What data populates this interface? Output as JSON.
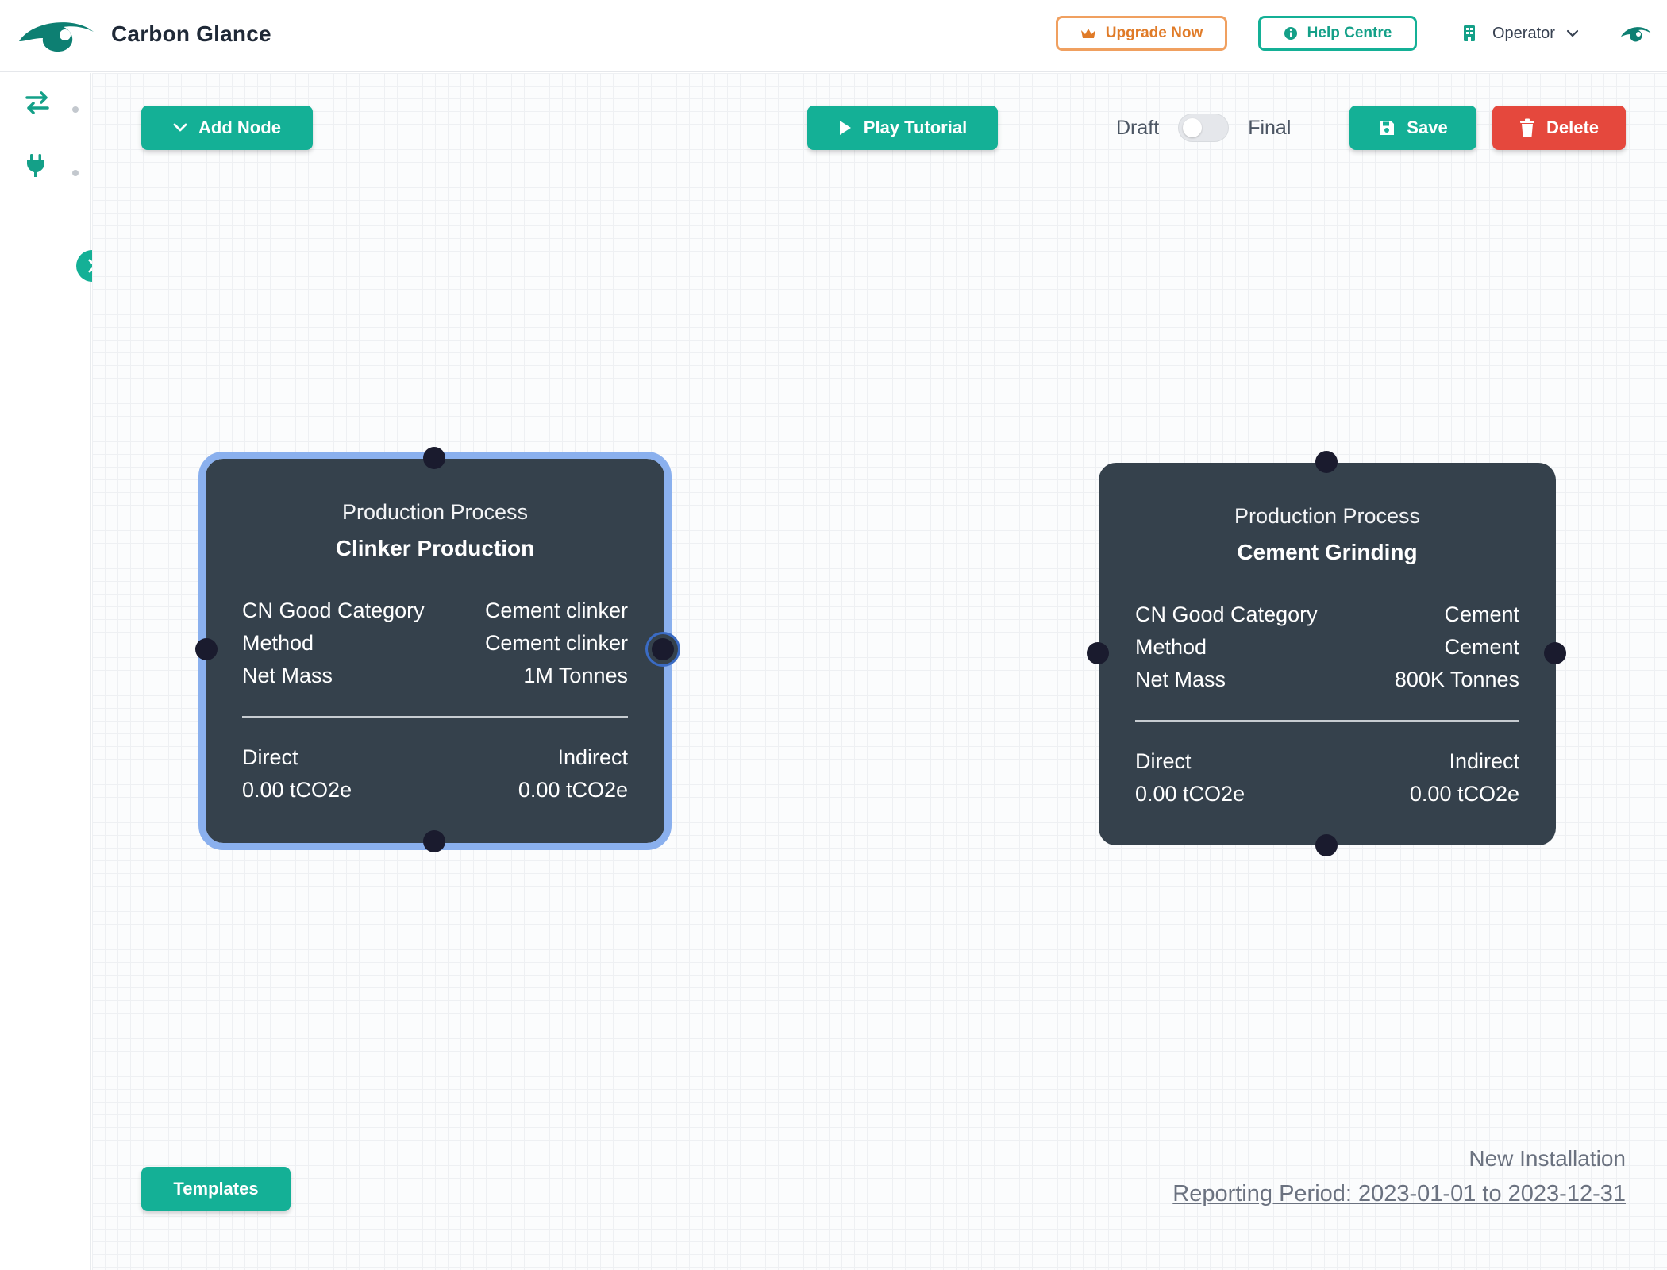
{
  "app": {
    "name": "Carbon Glance"
  },
  "header": {
    "upgrade_label": "Upgrade Now",
    "help_label": "Help Centre",
    "role_label": "Operator"
  },
  "toolbar": {
    "add_node_label": "Add Node",
    "play_tutorial_label": "Play Tutorial",
    "draft_label": "Draft",
    "final_label": "Final",
    "status_is_final": false,
    "save_label": "Save",
    "delete_label": "Delete"
  },
  "nodes": [
    {
      "type": "Production Process",
      "name": "Clinker Production",
      "selected": true,
      "rows": [
        {
          "label": "CN Good Category",
          "value": "Cement clinker"
        },
        {
          "label": "Method",
          "value": "Cement clinker"
        },
        {
          "label": "Net Mass",
          "value": "1M Tonnes"
        }
      ],
      "direct_label": "Direct",
      "direct_value": "0.00 tCO2e",
      "indirect_label": "Indirect",
      "indirect_value": "0.00 tCO2e"
    },
    {
      "type": "Production Process",
      "name": "Cement Grinding",
      "selected": false,
      "rows": [
        {
          "label": "CN Good Category",
          "value": "Cement"
        },
        {
          "label": "Method",
          "value": "Cement"
        },
        {
          "label": "Net Mass",
          "value": "800K Tonnes"
        }
      ],
      "direct_label": "Direct",
      "direct_value": "0.00 tCO2e",
      "indirect_label": "Indirect",
      "indirect_value": "0.00 tCO2e"
    }
  ],
  "footer": {
    "templates_label": "Templates",
    "installation_name": "New Installation",
    "reporting_period": "Reporting Period: 2023-01-01 to 2023-12-31"
  },
  "icons": {
    "brand": "eye-logo-icon",
    "upgrade": "crown-icon",
    "help": "info-icon",
    "role": "building-icon",
    "role_dropdown": "chevron-down-icon",
    "view": "eye-icon",
    "sidebar_flows": "transfer-arrows-icon",
    "sidebar_plug": "plug-icon",
    "sidebar_expand": "chevron-right-icon",
    "add_node": "chevron-down-icon",
    "play": "play-icon",
    "save": "floppy-disk-icon",
    "delete": "trash-icon"
  },
  "colors": {
    "brand_teal": "#14b096",
    "brand_dark_teal": "#0d7f72",
    "upgrade_orange": "#e07b28",
    "delete_red": "#e5483d",
    "node_bg": "#35414c",
    "selection_blue": "#8ab0ee"
  }
}
